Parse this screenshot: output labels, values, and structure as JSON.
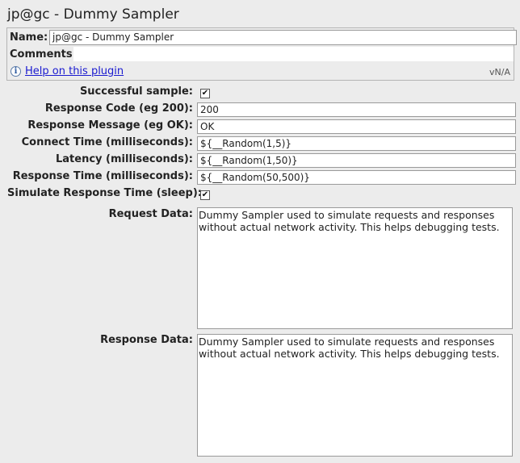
{
  "window": {
    "title": "jp@gc - Dummy Sampler"
  },
  "top": {
    "name_label": "Name:",
    "name_value": "jp@gc - Dummy Sampler",
    "comments_label": "Comments:",
    "comments_value": "",
    "help_icon": "info-icon",
    "help_link": "Help on this plugin",
    "version": "vN/A"
  },
  "form": {
    "successful_sample_label": "Successful sample:",
    "successful_sample_checked": true,
    "response_code_label": "Response Code (eg 200):",
    "response_code_value": "200",
    "response_message_label": "Response Message (eg OK):",
    "response_message_value": "OK",
    "connect_time_label": "Connect Time (milliseconds):",
    "connect_time_value": "${__Random(1,5)}",
    "latency_label": "Latency (milliseconds):",
    "latency_value": "${__Random(1,50)}",
    "response_time_label": "Response Time (milliseconds):",
    "response_time_value": "${__Random(50,500)}",
    "simulate_label": "Simulate Response Time (sleep):",
    "simulate_checked": true,
    "checkmark": "✔",
    "request_data_label": "Request Data:",
    "request_data_value": "Dummy Sampler used to simulate requests and responses\nwithout actual network activity. This helps debugging tests.",
    "response_data_label": "Response Data:",
    "response_data_value": "Dummy Sampler used to simulate requests and responses\nwithout actual network activity. This helps debugging tests."
  }
}
